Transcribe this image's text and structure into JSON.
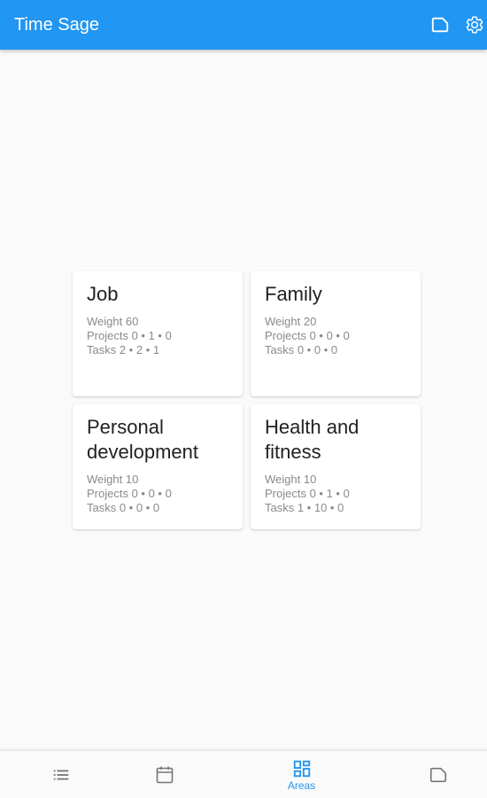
{
  "appbar": {
    "title": "Time Sage",
    "actions": [
      {
        "icon": "tag-icon"
      },
      {
        "icon": "settings-icon"
      }
    ],
    "color": "#2196f3"
  },
  "areas": [
    {
      "name": "Job",
      "weight": "Weight 60",
      "projects": "Projects 0 • 1 • 0",
      "tasks": "Tasks 2 • 2 • 1"
    },
    {
      "name": "Family",
      "weight": "Weight 20",
      "projects": "Projects 0 • 0 • 0",
      "tasks": "Tasks 0 • 0 • 0"
    },
    {
      "name": "Personal development",
      "weight": "Weight 10",
      "projects": "Projects 0 • 0 • 0",
      "tasks": "Tasks 0 • 0 • 0"
    },
    {
      "name": "Health and fitness",
      "weight": "Weight 10",
      "projects": "Projects 0 • 1 • 0",
      "tasks": "Tasks 1 • 10 • 0"
    }
  ],
  "bottom_nav": {
    "items": [
      {
        "icon": "list-icon",
        "label": ""
      },
      {
        "icon": "calendar-icon",
        "label": ""
      },
      {
        "icon": "areas-icon",
        "label": "Areas",
        "active": true
      },
      {
        "icon": "tag-icon",
        "label": ""
      }
    ],
    "active_color": "#2196f3",
    "inactive_color": "#757575"
  }
}
